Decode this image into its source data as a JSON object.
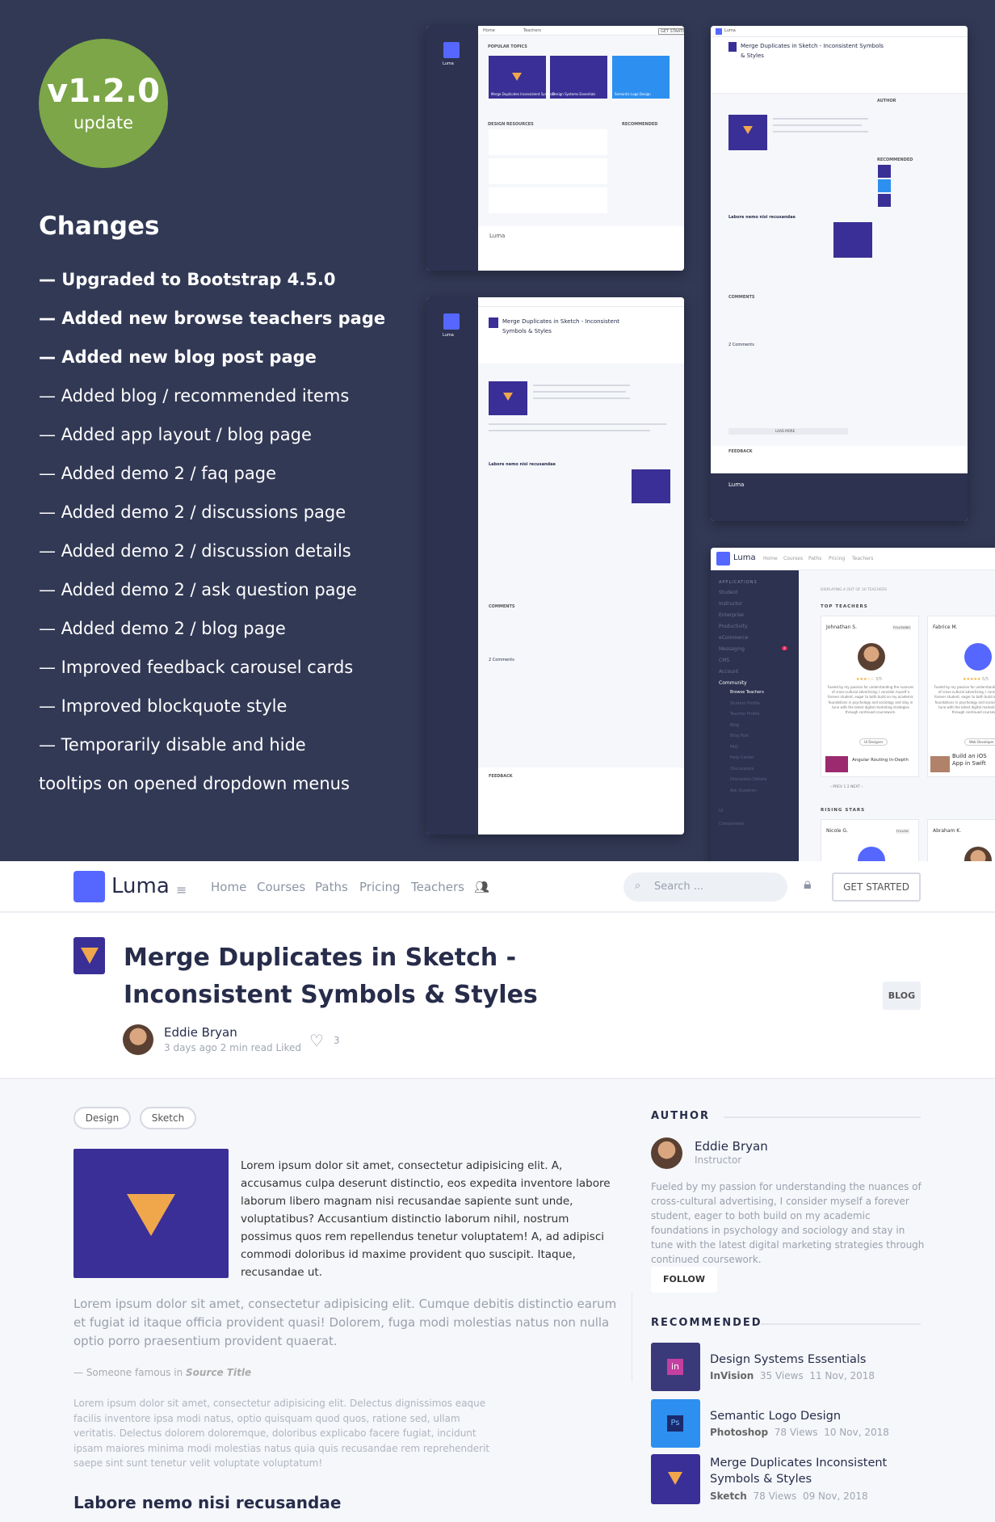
{
  "promo": {
    "version": "v1.2.0",
    "version_sub": "update",
    "changes_title": "Changes",
    "changes": [
      "— Upgraded to Bootstrap 4.5.0",
      "— Added new browse teachers page",
      "— Added new blog post page",
      "— Added blog / recommended items",
      "— Added app layout / blog page",
      "— Added demo 2 / faq page",
      "— Added demo 2 / discussions page",
      "— Added demo 2 / discussion details",
      "— Added demo 2 / ask question page",
      "— Added demo 2 / blog page",
      "— Improved feedback carousel cards",
      "— Improved blockquote style",
      "— Temporarily disable and hide",
      "tooltips on opened dropdown menus"
    ],
    "badge_color": "#7ca647",
    "bg_color": "#323955"
  },
  "mockups": {
    "brand": "Luma",
    "nav": [
      "Home",
      "Courses",
      "Paths",
      "Pricing",
      "Teachers"
    ],
    "get_started": "GET STARTED",
    "popular_topics": "POPULAR TOPICS",
    "topic_cards": [
      "Merge Duplicates Inconsistent Symbols",
      "Design Systems Essentials",
      "Semantic Logo Design"
    ],
    "design_resources": "DESIGN RESOURCES",
    "recommended": "RECOMMENDED",
    "post_title": "Merge Duplicates in Sketch - Inconsistent Symbols & Styles",
    "labore": "Labore nemo nisi recusandae",
    "comments": "COMMENTS",
    "two_comments": "2 Comments",
    "feedback": "FEEDBACK",
    "load_more": "LOAD MORE",
    "teachers": {
      "sidebar_heading": "APPLICATIONS",
      "sidebar": [
        "Student",
        "Instructor",
        "Enterprise",
        "Productivity",
        "eCommerce",
        "Messaging",
        "CMS",
        "Account",
        "Community"
      ],
      "messaging_badge": "2",
      "community_sub": [
        "Browse Teachers",
        "Student Profile",
        "Teacher Profile",
        "Blog",
        "Blog Post",
        "FAQ",
        "Help Center",
        "Discussions",
        "Discussion Details",
        "Ask Question"
      ],
      "ui_heading": "UI",
      "components": "Components",
      "displaying": "DISPLAYING 4 OUT OF 10 TEACHERS",
      "top_teachers": "TOP TEACHERS",
      "cards": [
        {
          "name": "Johnathan S.",
          "action": "FOLLOWING",
          "rating": "3/5",
          "role": "UI Designer",
          "course": "Angular Routing In-Depth"
        },
        {
          "name": "Fabrice M.",
          "action": "",
          "rating": "5/5",
          "role": "Web Developer",
          "course": "Build an iOS App in Swift"
        }
      ],
      "bio": "Fueled by my passion for understanding the nuances of cross-cultural advertising, I consider myself a forever student, eager to both build on my academic foundations in psychology and sociology and stay in tune with the latest digital marketing strategies through continued coursework.",
      "pagination": [
        "‹ PREV",
        "1",
        "2",
        "NEXT ›"
      ],
      "rising_stars": "RISING STARS",
      "rising": [
        {
          "name": "Nicole G.",
          "action": "FOLLOW"
        },
        {
          "name": "Abraham K."
        }
      ]
    }
  },
  "navbar": {
    "brand": "Luma",
    "links": [
      "Home",
      "Courses",
      "Paths",
      "Pricing",
      "Teachers"
    ],
    "search_placeholder": "Search ...",
    "get_started": "GET STARTED"
  },
  "post": {
    "title": "Merge Duplicates in Sketch - Inconsistent Symbols & Styles",
    "category_button": "BLOG",
    "author": "Eddie Bryan",
    "meta": "3 days ago  2 min read  Liked",
    "likes": "3",
    "tags": [
      "Design",
      "Sketch"
    ],
    "p1": "Lorem ipsum dolor sit amet, consectetur adipisicing elit. A, accusamus culpa deserunt distinctio, eos expedita inventore labore laborum libero magnam nisi recusandae sapiente sunt unde, voluptatibus? Accusantium distinctio laborum nihil, nostrum possimus quos rem repellendus tenetur voluptatem! A, ad adipisci commodi doloribus id maxime provident quo suscipit. Itaque, recusandae ut.",
    "p2": "Lorem ipsum dolor sit amet, consectetur adipisicing elit. Cumque debitis distinctio earum et fugiat id itaque officia provident quasi! Dolorem, fuga modi molestias natus non nulla optio porro praesentium provident quaerat.",
    "quote_prefix": "— Someone famous in ",
    "quote_source": "Source Title",
    "p3": "Lorem ipsum dolor sit amet, consectetur adipisicing elit. Delectus dignissimos eaque facilis inventore ipsa modi natus, optio quisquam quod quos, ratione sed, ullam veritatis. Delectus dolorem doloremque, doloribus explicabo facere fugiat, incidunt ipsam maiores minima modi molestias natus quia quis recusandae rem reprehenderit saepe sint sunt tenetur velit voluptate voluptatum!",
    "subheading": "Labore nemo nisi recusandae"
  },
  "sidebar": {
    "author_heading": "AUTHOR",
    "author_name": "Eddie Bryan",
    "author_role": "Instructor",
    "author_bio": "Fueled by my passion for understanding the nuances of cross-cultural advertising, I consider myself a forever student, eager to both build on my academic foundations in psychology and sociology and stay in tune with the latest digital marketing strategies through continued coursework.",
    "follow": "FOLLOW",
    "recommended_heading": "RECOMMENDED",
    "recommended": [
      {
        "title": "Design Systems Essentials",
        "tool": "InVision",
        "views": "35 Views",
        "date": "11 Nov, 2018",
        "icon": "in",
        "color": "#3a3a7a"
      },
      {
        "title": "Semantic Logo Design",
        "tool": "Photoshop",
        "views": "78 Views",
        "date": "10 Nov, 2018",
        "icon": "Ps",
        "color": "#2d8ff0"
      },
      {
        "title": "Merge Duplicates Inconsistent Symbols & Styles",
        "tool": "Sketch",
        "views": "78 Views",
        "date": "09 Nov, 2018",
        "icon": "sketch",
        "color": "#3a2f96"
      }
    ]
  }
}
